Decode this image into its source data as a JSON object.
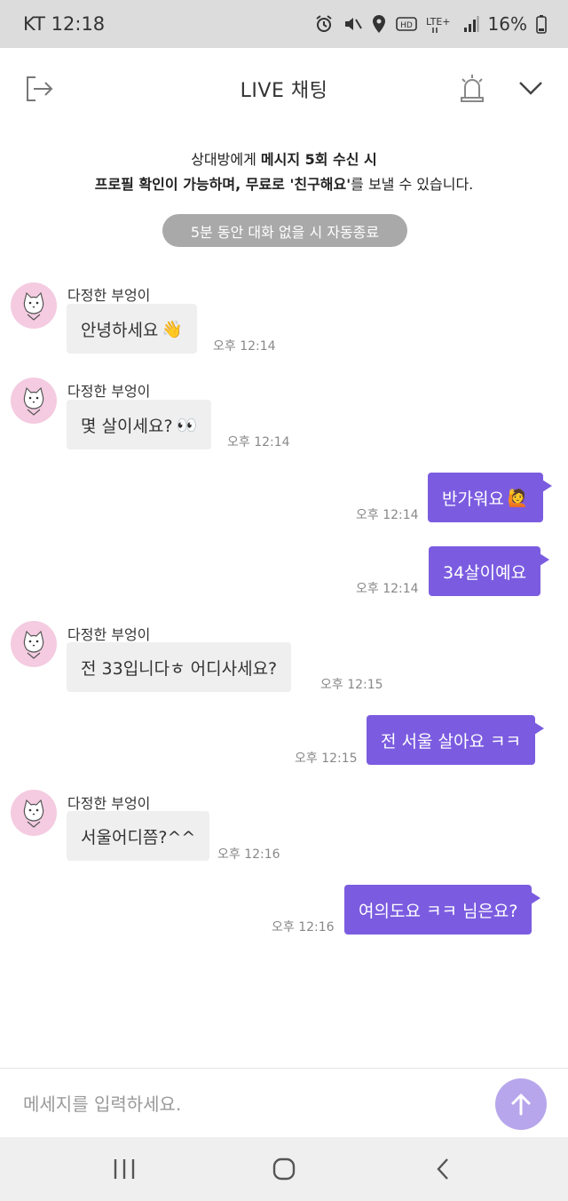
{
  "status_bar": {
    "carrier_time": "KT 12:18",
    "battery": "16%"
  },
  "header": {
    "title": "LIVE 채팅"
  },
  "notice": {
    "line1_pre": "상대방에게 ",
    "line1_bold": "메시지 5회 수신 시",
    "line2_bold_a": "프로필 확인이 가능하며, 무료로 '친구해요'",
    "line2_post": "를 보낼 수 있습니다.",
    "auto_end": "5분 동안 대화 없을 시 자동종료"
  },
  "messages": [
    {
      "side": "in",
      "sender": "다정한 부엉이",
      "text": "안녕하세요",
      "emoji": "👋",
      "time": "오후 12:14"
    },
    {
      "side": "in",
      "sender": "다정한 부엉이",
      "text": "몇 살이세요?",
      "emoji": "👀",
      "time": "오후 12:14"
    },
    {
      "side": "out",
      "text": "반가워요",
      "emoji": "🙋",
      "time": "오후 12:14"
    },
    {
      "side": "out",
      "text": "34살이예요",
      "time": "오후 12:14"
    },
    {
      "side": "in",
      "sender": "다정한 부엉이",
      "text": "전 33입니다ㅎ 어디사세요?",
      "time": "오후 12:15"
    },
    {
      "side": "out",
      "text": "전 서울 살아요 ㅋㅋ",
      "time": "오후 12:15"
    },
    {
      "side": "in",
      "sender": "다정한 부엉이",
      "text": "서울어디쯤?^^",
      "time": "오후 12:16"
    },
    {
      "side": "out",
      "text": "여의도요 ㅋㅋ 님은요?",
      "time": "오후 12:16"
    }
  ],
  "input": {
    "placeholder": "메세지를 입력하세요."
  },
  "colors": {
    "accent": "#7b5ce0",
    "send_button": "#b7a6ec",
    "avatar_bg": "#f4cbe0",
    "incoming_bubble": "#efefef"
  },
  "icons": [
    "alarm-icon",
    "mute-icon",
    "location-icon",
    "hd-icon",
    "lte-icon",
    "signal-icon",
    "battery-icon",
    "exit-icon",
    "siren-icon",
    "chevron-down-icon",
    "owl-avatar-icon",
    "send-arrow-icon",
    "recent-apps-icon",
    "home-icon",
    "back-icon"
  ]
}
